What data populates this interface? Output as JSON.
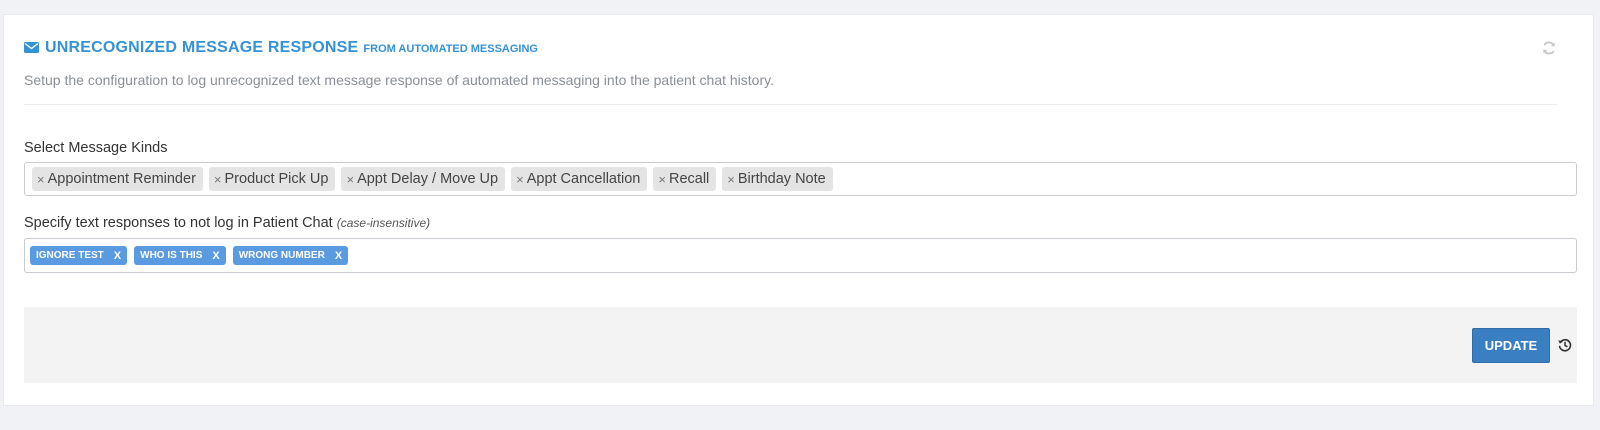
{
  "header": {
    "title": "UNRECOGNIZED MESSAGE RESPONSE",
    "subtitle": "FROM AUTOMATED MESSAGING",
    "icon": "envelope-icon",
    "refresh_icon": "refresh-icon"
  },
  "description": "Setup the configuration to log unrecognized text message response of automated messaging into the patient chat history.",
  "message_kinds": {
    "label": "Select Message Kinds",
    "selected": [
      "Appointment Reminder",
      "Product Pick Up",
      "Appt Delay / Move Up",
      "Appt Cancellation",
      "Recall",
      "Birthday Note"
    ],
    "remove_glyph": "×"
  },
  "text_responses": {
    "label": "Specify text responses to not log in Patient Chat",
    "label_note": "(case-insensitive)",
    "tags": [
      "IGNORE TEST",
      "WHO IS THIS",
      "WRONG NUMBER"
    ],
    "remove_glyph": "X"
  },
  "footer": {
    "update_label": "UPDATE",
    "history_icon": "history-icon"
  },
  "colors": {
    "accent": "#3592d6",
    "tag_bg": "#5a9ae0",
    "button_bg": "#3a7fc1"
  }
}
